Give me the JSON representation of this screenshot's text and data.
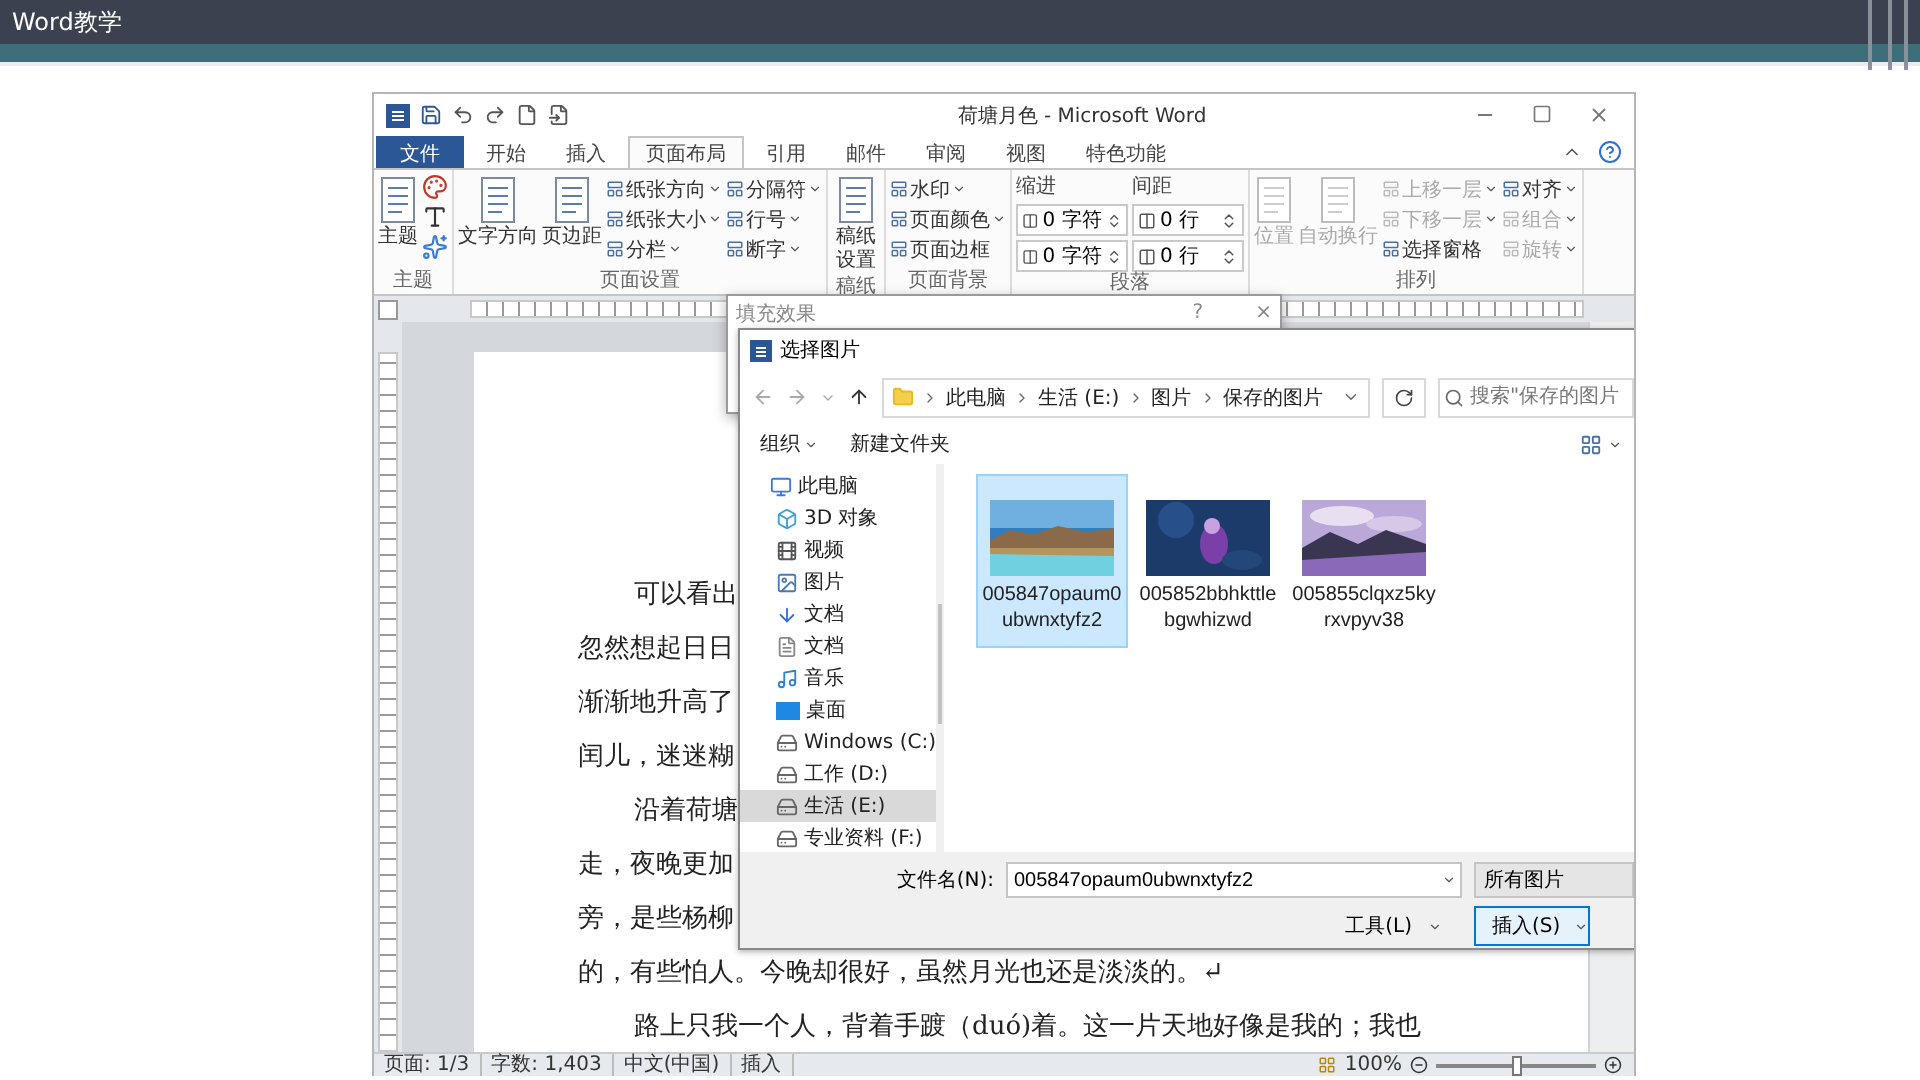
{
  "slide": {
    "title": "Word教学"
  },
  "window": {
    "title": "荷塘月色 - Microsoft Word"
  },
  "tabs": [
    {
      "label": "文件",
      "kind": "backstage",
      "selected": false
    },
    {
      "label": "开始",
      "kind": "tab",
      "selected": false
    },
    {
      "label": "插入",
      "kind": "tab",
      "selected": false
    },
    {
      "label": "页面布局",
      "kind": "tab",
      "selected": true
    },
    {
      "label": "引用",
      "kind": "tab",
      "selected": false
    },
    {
      "label": "邮件",
      "kind": "tab",
      "selected": false
    },
    {
      "label": "审阅",
      "kind": "tab",
      "selected": false
    },
    {
      "label": "视图",
      "kind": "tab",
      "selected": false
    },
    {
      "label": "特色功能",
      "kind": "tab",
      "selected": false
    }
  ],
  "ribbon": [
    {
      "label": "主题",
      "items": [
        {
          "kind": "large",
          "label": "主题"
        },
        {
          "kind": "theme-tools"
        }
      ]
    },
    {
      "label": "页面设置",
      "items": [
        {
          "kind": "large",
          "label": "文字方向"
        },
        {
          "kind": "large",
          "label": "页边距"
        },
        {
          "kind": "small",
          "label": "纸张方向",
          "menu": true
        },
        {
          "kind": "small",
          "label": "纸张大小",
          "menu": true
        },
        {
          "kind": "small",
          "label": "分栏",
          "menu": true
        },
        {
          "kind": "small",
          "label": "分隔符",
          "menu": true
        },
        {
          "kind": "small",
          "label": "行号",
          "menu": true
        },
        {
          "kind": "small",
          "label": "断字",
          "menu": true
        }
      ]
    },
    {
      "label": "稿纸",
      "items": [
        {
          "kind": "stacked",
          "label": "稿纸设置"
        }
      ]
    },
    {
      "label": "页面背景",
      "items": [
        {
          "kind": "small",
          "label": "水印",
          "menu": true
        },
        {
          "kind": "small",
          "label": "页面颜色",
          "menu": true
        },
        {
          "kind": "small",
          "label": "页面边框",
          "menu": false
        }
      ]
    },
    {
      "label": "段落",
      "items": [
        {
          "kind": "spin-column",
          "label": "缩进",
          "fields": [
            "0 字符",
            "0 字符"
          ]
        },
        {
          "kind": "spin-column",
          "label": "间距",
          "fields": [
            "0 行",
            "0 行"
          ]
        }
      ]
    },
    {
      "label": "排列",
      "items": [
        {
          "kind": "large",
          "label": "位置",
          "disabled": true
        },
        {
          "kind": "large",
          "label": "自动换行",
          "disabled": true
        },
        {
          "kind": "small",
          "label": "上移一层",
          "menu": true,
          "disabled": true
        },
        {
          "kind": "small",
          "label": "下移一层",
          "menu": true,
          "disabled": true
        },
        {
          "kind": "small",
          "label": "选择窗格",
          "menu": false,
          "disabled": false
        },
        {
          "kind": "small",
          "label": "对齐",
          "menu": true,
          "disabled": false
        },
        {
          "kind": "small",
          "label": "组合",
          "menu": true,
          "disabled": true
        },
        {
          "kind": "small",
          "label": "旋转",
          "menu": true,
          "disabled": true
        }
      ]
    }
  ],
  "document": {
    "lines": [
      {
        "text": "可以看出",
        "indent": true
      },
      {
        "text": "忽然想起日日",
        "indent": false
      },
      {
        "text": "渐渐地升高了",
        "indent": false
      },
      {
        "text": "闰儿，迷迷糊",
        "indent": false
      },
      {
        "text": "沿着荷塘",
        "indent": true
      },
      {
        "text": "走，夜晚更加",
        "indent": false
      },
      {
        "text": "旁，是些杨柳",
        "indent": false
      },
      {
        "text": "的，有些怕人。今晚却很好，虽然月光也还是淡淡的。↵",
        "indent": false
      },
      {
        "text": "路上只我一个人，背着手踱（duó)着。这一片天地好像是我的；我也",
        "indent": true
      }
    ]
  },
  "fill_dialog": {
    "title": "填充效果",
    "buttons": [
      "?",
      "×"
    ]
  },
  "picker": {
    "title": "选择图片",
    "path": [
      "此电脑",
      "生活 (E:)",
      "图片",
      "保存的图片"
    ],
    "search": {
      "placeholder": "搜索\"保存的图片"
    },
    "toolbar": [
      {
        "label": "组织",
        "menu": true
      },
      {
        "label": "新建文件夹",
        "menu": false
      }
    ],
    "tree": [
      {
        "label": "此电脑",
        "kind": "pc",
        "selected": false
      },
      {
        "label": "3D 对象",
        "kind": "object",
        "selected": false
      },
      {
        "label": "视频",
        "kind": "video",
        "selected": false
      },
      {
        "label": "图片",
        "kind": "pictures",
        "selected": false
      },
      {
        "label": "文档",
        "kind": "downloads",
        "selected": false
      },
      {
        "label": "文档",
        "kind": "documents",
        "selected": false
      },
      {
        "label": "音乐",
        "kind": "music",
        "selected": false
      },
      {
        "label": "桌面",
        "kind": "desktop",
        "selected": false
      },
      {
        "label": "Windows (C:)",
        "kind": "drive",
        "selected": false
      },
      {
        "label": "工作 (D:)",
        "kind": "drive",
        "selected": false
      },
      {
        "label": "生活 (E:)",
        "kind": "drive",
        "selected": true
      },
      {
        "label": "专业资料 (F:)",
        "kind": "drive",
        "selected": false
      }
    ],
    "files": [
      {
        "name": "005847opaum0ubwnxtyfz2",
        "kind": "picture",
        "selected": true
      },
      {
        "name": "005852bbhkttlebgwhizwd",
        "kind": "picture",
        "selected": false
      },
      {
        "name": "005855clqxz5kyrxvpyv38",
        "kind": "picture",
        "selected": false
      }
    ],
    "filename": {
      "label": "文件名(N):",
      "value": "005847opaum0ubwnxtyfz2"
    },
    "filter": "所有图片",
    "tools": "工具(L)",
    "insert": "插入(S)"
  },
  "status_bar": {
    "items": [
      "页面: 1/3",
      "字数: 1,403",
      "中文(中国)",
      "插入"
    ],
    "zoom": {
      "reading": "100%",
      "level": 0.5
    }
  }
}
